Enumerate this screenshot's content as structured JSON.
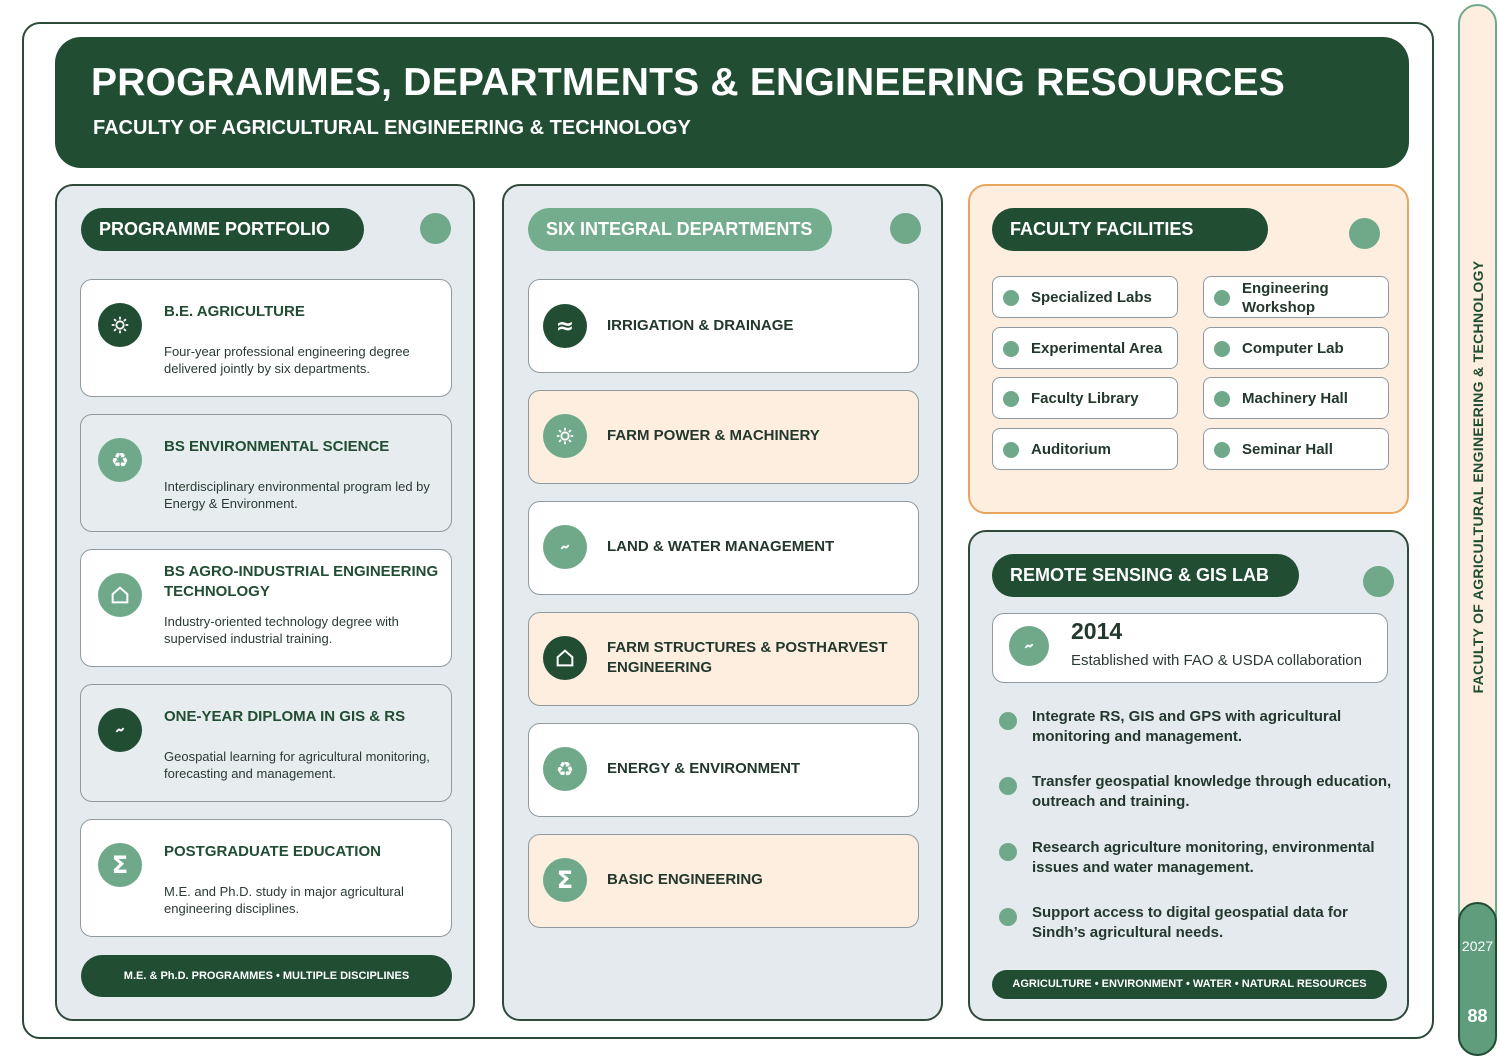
{
  "header": {
    "title": "PROGRAMMES, DEPARTMENTS & ENGINEERING RESOURCES",
    "subtitle": "FACULTY OF AGRICULTURAL ENGINEERING & TECHNOLOGY"
  },
  "portfolio": {
    "title": "PROGRAMME PORTFOLIO",
    "items": [
      {
        "title": "B.E. AGRICULTURE",
        "desc": "Four-year professional engineering degree delivered jointly by six departments.",
        "icon": "gear-icon"
      },
      {
        "title": "BS ENVIRONMENTAL SCIENCE",
        "desc": "Interdisciplinary environmental program led by Energy & Environment.",
        "icon": "recycle-icon"
      },
      {
        "title": "BS AGRO-INDUSTRIAL ENGINEERING TECHNOLOGY",
        "desc": "Industry-oriented technology degree with supervised industrial training.",
        "icon": "house-icon"
      },
      {
        "title": "ONE-YEAR DIPLOMA IN GIS & RS",
        "desc": "Geospatial learning for agricultural monitoring, forecasting and management.",
        "icon": "satellite-icon"
      },
      {
        "title": "POSTGRADUATE EDUCATION",
        "desc": "M.E. and Ph.D. study in major agricultural engineering disciplines.",
        "icon": "sigma-icon"
      }
    ],
    "footer": "M.E. & Ph.D. PROGRAMMES • MULTIPLE DISCIPLINES"
  },
  "departments": {
    "title": "SIX INTEGRAL DEPARTMENTS",
    "items": [
      {
        "title": "IRRIGATION & DRAINAGE",
        "icon": "water-wave-icon"
      },
      {
        "title": "FARM POWER & MACHINERY",
        "icon": "gear-icon"
      },
      {
        "title": "LAND & WATER MANAGEMENT",
        "icon": "satellite-icon"
      },
      {
        "title": "FARM STRUCTURES & POSTHARVEST ENGINEERING",
        "icon": "house-icon"
      },
      {
        "title": "ENERGY & ENVIRONMENT",
        "icon": "recycle-icon"
      },
      {
        "title": "BASIC ENGINEERING",
        "icon": "sigma-icon"
      }
    ]
  },
  "facilities": {
    "title": "FACULTY FACILITIES",
    "items": [
      "Specialized Labs",
      "Engineering Workshop",
      "Experimental Area",
      "Computer Lab",
      "Faculty Library",
      "Machinery Hall",
      "Auditorium",
      "Seminar Hall"
    ]
  },
  "rs_lab": {
    "title": "REMOTE SENSING & GIS LAB",
    "year": "2014",
    "established": "Established with FAO & USDA collaboration",
    "bullets": [
      "Integrate RS, GIS and GPS with agricultural monitoring and management.",
      "Transfer geospatial knowledge through education, outreach and training.",
      "Research agriculture monitoring, environmental issues and water management.",
      "Support access to digital geospatial data for Sindh’s agricultural needs."
    ],
    "footer": "AGRICULTURE • ENVIRONMENT • WATER • NATURAL RESOURCES"
  },
  "side": {
    "label": "FACULTY OF AGRICULTURAL  ENGINEERING & TECHNOLOGY",
    "year": "2027",
    "page": "88"
  },
  "colors": {
    "dark_green": "#214d33",
    "light_green": "#6fa98a",
    "peach": "#fdeee0",
    "orange_border": "#e9a45e",
    "panel_grey": "#e4eaee"
  }
}
